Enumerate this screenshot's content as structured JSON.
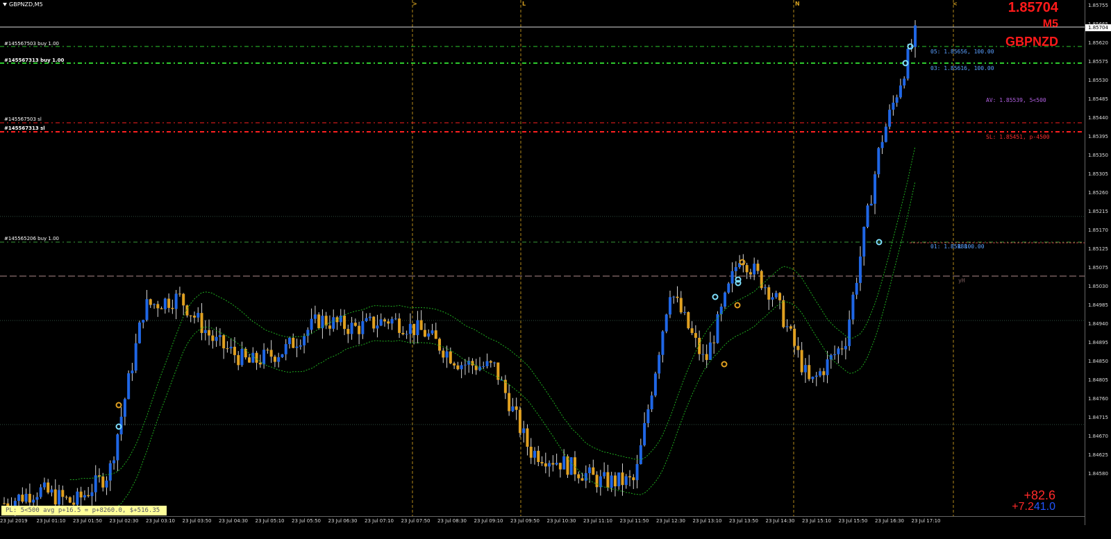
{
  "window": {
    "title": "GBPNZD,M5"
  },
  "overlay": {
    "price": "1.85704",
    "timeframe": "M5",
    "symbol": "GBPNZD",
    "pnl_pips": "+82.6",
    "pnl_money_a": "+7.2",
    "pnl_money_b": "41.0",
    "pl_summary": "PL: 5<500 avg p+16.5 = p+8260.0, $+516.35"
  },
  "orders": [
    {
      "label": "#145567503 buy 1.00",
      "price": 1.85656
    },
    {
      "label": "#145567313 buy 1.00",
      "price": 1.85616
    },
    {
      "label": "#145567503 sl",
      "price": 1.85475
    },
    {
      "label": "#145567313 sl",
      "price": 1.85451
    },
    {
      "label": "#145565206 buy 1.00",
      "price": 1.85188
    }
  ],
  "right_labels": {
    "o5": "05: 1.85656, 100.00",
    "o3": "03: 1.85616, 100.00",
    "av": "AV: 1.85539, 5<500",
    "sl": "SL: 1.85451, p-4500",
    "o1": "01: 1.85188",
    "o1b": "R 100.00",
    "yh": "yH"
  },
  "vertical_markers": [
    ">",
    "L",
    "N",
    "<"
  ],
  "price_scale": {
    "current": "1.85704",
    "labels": [
      "1.85755",
      "1.85665",
      "1.85620",
      "1.85575",
      "1.85530",
      "1.85485",
      "1.85440",
      "1.85395",
      "1.85350",
      "1.85305",
      "1.85260",
      "1.85215",
      "1.85170",
      "1.85125",
      "1.85075",
      "1.85030",
      "1.84985",
      "1.84940",
      "1.84895",
      "1.84850",
      "1.84805",
      "1.84760",
      "1.84715",
      "1.84670",
      "1.84625",
      "1.84580"
    ]
  },
  "time_scale": {
    "labels": [
      "23 Jul 2019",
      "23 Jul 01:10",
      "23 Jul 01:50",
      "23 Jul 02:30",
      "23 Jul 03:10",
      "23 Jul 03:50",
      "23 Jul 04:30",
      "23 Jul 05:10",
      "23 Jul 05:50",
      "23 Jul 06:30",
      "23 Jul 07:10",
      "23 Jul 07:50",
      "23 Jul 08:30",
      "23 Jul 09:10",
      "23 Jul 09:50",
      "23 Jul 10:30",
      "23 Jul 11:10",
      "23 Jul 11:50",
      "23 Jul 12:30",
      "23 Jul 13:10",
      "23 Jul 13:50",
      "23 Jul 14:30",
      "23 Jul 15:10",
      "23 Jul 15:50",
      "23 Jul 16:30",
      "23 Jul 17:10"
    ]
  },
  "colors": {
    "bull": "#1f66e5",
    "bear": "#e0a020",
    "wick": "#d8d8d8",
    "ma": "#1fae1f",
    "buy_line": "#2ecc2e",
    "sl_line": "#ff2020",
    "yh_line": "#b08a8a",
    "fib_line": "#b38a1a",
    "grid": "#334433"
  },
  "chart_data": {
    "type": "candlestick",
    "symbol": "GBPNZD",
    "timeframe": "M5",
    "close_path": [
      [
        "23 Jul 00:30",
        1.8463
      ],
      [
        "23 Jul 01:10",
        1.8466
      ],
      [
        "23 Jul 01:50",
        1.8463
      ],
      [
        "23 Jul 02:20",
        1.847
      ],
      [
        "23 Jul 02:30",
        1.8508
      ],
      [
        "23 Jul 03:10",
        1.851
      ],
      [
        "23 Jul 03:50",
        1.85
      ],
      [
        "23 Jul 04:30",
        1.8495
      ],
      [
        "23 Jul 05:10",
        1.8498
      ],
      [
        "23 Jul 05:50",
        1.8505
      ],
      [
        "23 Jul 06:30",
        1.8503
      ],
      [
        "23 Jul 07:10",
        1.8505
      ],
      [
        "23 Jul 07:50",
        1.8502
      ],
      [
        "23 Jul 08:30",
        1.8495
      ],
      [
        "23 Jul 09:10",
        1.8494
      ],
      [
        "23 Jul 09:50",
        1.8475
      ],
      [
        "23 Jul 10:30",
        1.8472
      ],
      [
        "23 Jul 11:10",
        1.8468
      ],
      [
        "23 Jul 11:50",
        1.8468
      ],
      [
        "23 Jul 12:30",
        1.8512
      ],
      [
        "23 Jul 13:10",
        1.8495
      ],
      [
        "23 Jul 13:50",
        1.852
      ],
      [
        "23 Jul 14:30",
        1.851
      ],
      [
        "23 Jul 15:10",
        1.849
      ],
      [
        "23 Jul 15:50",
        1.85
      ],
      [
        "23 Jul 16:30",
        1.8545
      ],
      [
        "23 Jul 17:10",
        1.857
      ]
    ],
    "ylim": [
      1.8458,
      1.8578
    ]
  }
}
